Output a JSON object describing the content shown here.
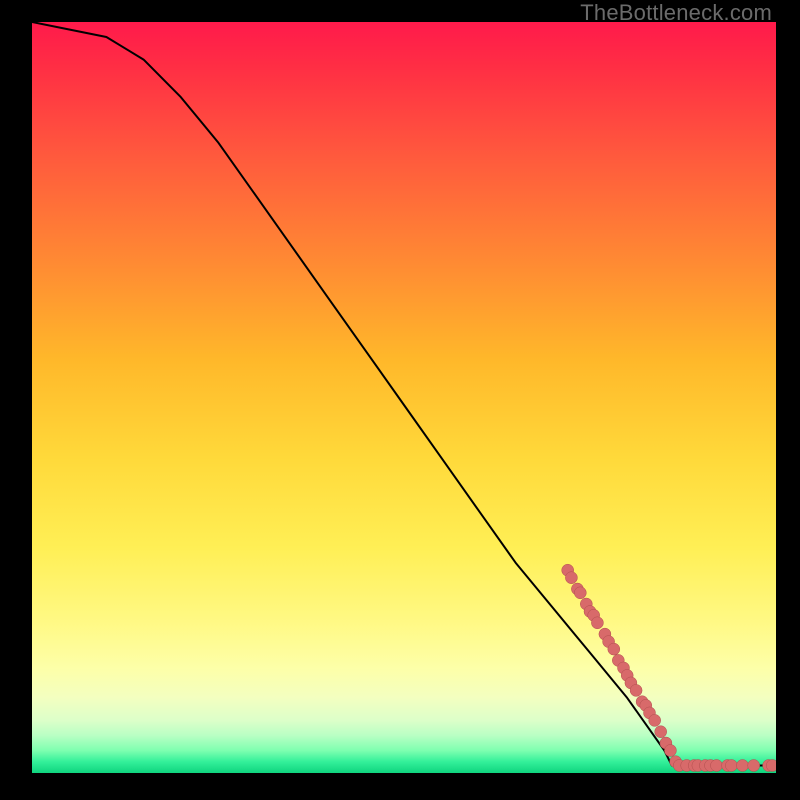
{
  "watermark": "TheBottleneck.com",
  "colors": {
    "background": "#000000",
    "gradient_top": "#ff1a4b",
    "gradient_bottom": "#0fd47e",
    "curve": "#000000",
    "dots": "#d86a6a"
  },
  "chart_data": {
    "type": "line",
    "title": "",
    "xlabel": "",
    "ylabel": "",
    "xlim": [
      0,
      100
    ],
    "ylim": [
      0,
      100
    ],
    "grid": false,
    "series": [
      {
        "name": "bottleneck-curve",
        "x": [
          0,
          5,
          10,
          15,
          20,
          25,
          30,
          35,
          40,
          45,
          50,
          55,
          60,
          65,
          70,
          75,
          80,
          85,
          86,
          88,
          90,
          92,
          94,
          96,
          98,
          100
        ],
        "values": [
          100,
          99,
          98,
          95,
          90,
          84,
          77,
          70,
          63,
          56,
          49,
          42,
          35,
          28,
          22,
          16,
          10,
          3,
          1,
          1,
          1,
          1,
          1,
          1,
          1,
          1
        ]
      }
    ],
    "scatter_points": {
      "name": "highlight-dots",
      "points": [
        {
          "x": 72,
          "y": 27
        },
        {
          "x": 72.5,
          "y": 26
        },
        {
          "x": 73.3,
          "y": 24.5
        },
        {
          "x": 73.7,
          "y": 24
        },
        {
          "x": 74.5,
          "y": 22.5
        },
        {
          "x": 75,
          "y": 21.5
        },
        {
          "x": 75.5,
          "y": 21
        },
        {
          "x": 76,
          "y": 20
        },
        {
          "x": 77,
          "y": 18.5
        },
        {
          "x": 77.5,
          "y": 17.5
        },
        {
          "x": 78.2,
          "y": 16.5
        },
        {
          "x": 78.8,
          "y": 15
        },
        {
          "x": 79.5,
          "y": 14
        },
        {
          "x": 80,
          "y": 13
        },
        {
          "x": 80.5,
          "y": 12
        },
        {
          "x": 81.2,
          "y": 11
        },
        {
          "x": 82,
          "y": 9.5
        },
        {
          "x": 82.5,
          "y": 9
        },
        {
          "x": 83,
          "y": 8
        },
        {
          "x": 83.7,
          "y": 7
        },
        {
          "x": 84.5,
          "y": 5.5
        },
        {
          "x": 85.2,
          "y": 4
        },
        {
          "x": 85.8,
          "y": 3
        },
        {
          "x": 86.5,
          "y": 1.5
        },
        {
          "x": 87,
          "y": 1
        },
        {
          "x": 88,
          "y": 1
        },
        {
          "x": 89,
          "y": 1
        },
        {
          "x": 89.5,
          "y": 1
        },
        {
          "x": 90.5,
          "y": 1
        },
        {
          "x": 91.2,
          "y": 1
        },
        {
          "x": 92,
          "y": 1
        },
        {
          "x": 93.5,
          "y": 1
        },
        {
          "x": 94,
          "y": 1
        },
        {
          "x": 95.5,
          "y": 1
        },
        {
          "x": 97,
          "y": 1
        },
        {
          "x": 99,
          "y": 1
        },
        {
          "x": 99.5,
          "y": 1
        }
      ]
    }
  }
}
